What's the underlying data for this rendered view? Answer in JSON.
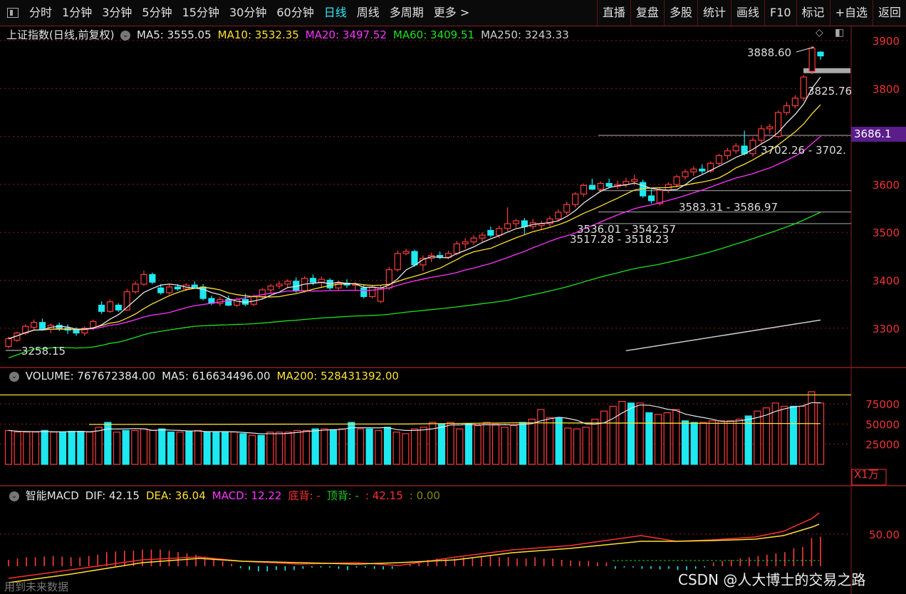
{
  "toolbar": {
    "periods": [
      "分时",
      "1分钟",
      "3分钟",
      "5分钟",
      "15分钟",
      "30分钟",
      "60分钟",
      "日线",
      "周线",
      "多周期",
      "更多 >"
    ],
    "active": "日线",
    "right": [
      "直播",
      "复盘",
      "多股",
      "统计",
      "画线",
      "F10",
      "标记",
      "+自选",
      "返回"
    ]
  },
  "price_panel": {
    "title": "上证指数(日线,前复权)",
    "ma_labels": [
      {
        "text": "MA5: 3555.05",
        "color": "#e6e6e6"
      },
      {
        "text": "MA10: 3532.35",
        "color": "#ffe033"
      },
      {
        "text": "MA20: 3497.52",
        "color": "#ff33ff"
      },
      {
        "text": "MA60: 3409.51",
        "color": "#1ee11e"
      },
      {
        "text": "MA250: 3243.33",
        "color": "#cccccc"
      }
    ],
    "axis_ticks": [
      "3900",
      "3800",
      "3700",
      "3600",
      "3500",
      "3400",
      "3300"
    ],
    "current_price": "3686.1",
    "high_label": "3888.60",
    "low_label": "3258.15",
    "level_labels": [
      "3825.76",
      "3702.26 - 3702.",
      "3583.31 - 3586.97",
      "3536.01 - 3542.57",
      "3517.28 - 3518.23"
    ]
  },
  "volume_panel": {
    "labels": [
      {
        "text": "VOLUME: 767672384.00",
        "color": "#e6e6e6"
      },
      {
        "text": "MA5: 616634496.00",
        "color": "#e6e6e6"
      },
      {
        "text": "MA200: 528431392.00",
        "color": "#ffe033"
      }
    ],
    "axis_ticks": [
      "75000",
      "50000",
      "25000"
    ],
    "unit": "X1万"
  },
  "macd_panel": {
    "labels": [
      {
        "text": "智能MACD",
        "color": "#e6e6e6"
      },
      {
        "text": "DIF: 42.15",
        "color": "#e6e6e6"
      },
      {
        "text": "DEA: 36.04",
        "color": "#ffe033"
      },
      {
        "text": "MACD: 12.22",
        "color": "#ff33ff"
      },
      {
        "text": "底背: -",
        "color": "#ff3030"
      },
      {
        "text": "顶背: -",
        "color": "#1ec81e"
      },
      {
        "text": ": 42.15",
        "color": "#ff3030"
      },
      {
        "text": ": 0.00",
        "color": "#888800"
      }
    ],
    "axis_ticks": [
      "50.00"
    ]
  },
  "footer_text": "用到未来数据",
  "watermark": "CSDN @人大博士的交易之路",
  "colors": {
    "up": "#ff3b3b",
    "down": "#1ee8f0",
    "ma5": "#e6e6e6",
    "ma10": "#ffe033",
    "ma20": "#ff33ff",
    "ma60": "#1ee11e",
    "ma250": "#cccccc",
    "grid": "#8a1e1e"
  },
  "chart_data": {
    "type": "candlestick",
    "title": "上证指数(日线,前复权)",
    "ylim": [
      3230,
      3920
    ],
    "candles": [
      {
        "o": 3262,
        "h": 3282,
        "l": 3258,
        "c": 3278
      },
      {
        "o": 3275,
        "h": 3293,
        "l": 3271,
        "c": 3290
      },
      {
        "o": 3290,
        "h": 3308,
        "l": 3286,
        "c": 3304
      },
      {
        "o": 3302,
        "h": 3318,
        "l": 3296,
        "c": 3312
      },
      {
        "o": 3312,
        "h": 3320,
        "l": 3295,
        "c": 3298
      },
      {
        "o": 3298,
        "h": 3310,
        "l": 3290,
        "c": 3306
      },
      {
        "o": 3306,
        "h": 3312,
        "l": 3294,
        "c": 3300
      },
      {
        "o": 3300,
        "h": 3308,
        "l": 3288,
        "c": 3296
      },
      {
        "o": 3296,
        "h": 3302,
        "l": 3284,
        "c": 3290
      },
      {
        "o": 3290,
        "h": 3304,
        "l": 3284,
        "c": 3300
      },
      {
        "o": 3300,
        "h": 3318,
        "l": 3296,
        "c": 3314
      },
      {
        "o": 3348,
        "h": 3356,
        "l": 3330,
        "c": 3335
      },
      {
        "o": 3335,
        "h": 3360,
        "l": 3332,
        "c": 3355
      },
      {
        "o": 3348,
        "h": 3352,
        "l": 3334,
        "c": 3338
      },
      {
        "o": 3338,
        "h": 3382,
        "l": 3336,
        "c": 3376
      },
      {
        "o": 3376,
        "h": 3398,
        "l": 3372,
        "c": 3392
      },
      {
        "o": 3392,
        "h": 3420,
        "l": 3388,
        "c": 3412
      },
      {
        "o": 3412,
        "h": 3416,
        "l": 3392,
        "c": 3396
      },
      {
        "o": 3384,
        "h": 3392,
        "l": 3370,
        "c": 3374
      },
      {
        "o": 3374,
        "h": 3392,
        "l": 3370,
        "c": 3386
      },
      {
        "o": 3386,
        "h": 3392,
        "l": 3378,
        "c": 3382
      },
      {
        "o": 3382,
        "h": 3394,
        "l": 3378,
        "c": 3390
      },
      {
        "o": 3390,
        "h": 3398,
        "l": 3383,
        "c": 3386
      },
      {
        "o": 3386,
        "h": 3392,
        "l": 3358,
        "c": 3362
      },
      {
        "o": 3362,
        "h": 3368,
        "l": 3348,
        "c": 3352
      },
      {
        "o": 3352,
        "h": 3366,
        "l": 3346,
        "c": 3360
      },
      {
        "o": 3360,
        "h": 3368,
        "l": 3346,
        "c": 3348
      },
      {
        "o": 3348,
        "h": 3364,
        "l": 3344,
        "c": 3360
      },
      {
        "o": 3360,
        "h": 3372,
        "l": 3346,
        "c": 3350
      },
      {
        "o": 3350,
        "h": 3370,
        "l": 3346,
        "c": 3366
      },
      {
        "o": 3366,
        "h": 3384,
        "l": 3362,
        "c": 3380
      },
      {
        "o": 3380,
        "h": 3392,
        "l": 3372,
        "c": 3388
      },
      {
        "o": 3388,
        "h": 3398,
        "l": 3382,
        "c": 3392
      },
      {
        "o": 3392,
        "h": 3402,
        "l": 3384,
        "c": 3398
      },
      {
        "o": 3398,
        "h": 3406,
        "l": 3374,
        "c": 3378
      },
      {
        "o": 3378,
        "h": 3408,
        "l": 3374,
        "c": 3404
      },
      {
        "o": 3404,
        "h": 3412,
        "l": 3390,
        "c": 3396
      },
      {
        "o": 3396,
        "h": 3408,
        "l": 3384,
        "c": 3402
      },
      {
        "o": 3400,
        "h": 3404,
        "l": 3380,
        "c": 3384
      },
      {
        "o": 3384,
        "h": 3398,
        "l": 3378,
        "c": 3394
      },
      {
        "o": 3394,
        "h": 3402,
        "l": 3384,
        "c": 3390
      },
      {
        "o": 3390,
        "h": 3396,
        "l": 3380,
        "c": 3392
      },
      {
        "o": 3384,
        "h": 3392,
        "l": 3362,
        "c": 3366
      },
      {
        "o": 3366,
        "h": 3390,
        "l": 3362,
        "c": 3386
      },
      {
        "o": 3356,
        "h": 3390,
        "l": 3352,
        "c": 3384
      },
      {
        "o": 3384,
        "h": 3428,
        "l": 3380,
        "c": 3422
      },
      {
        "o": 3422,
        "h": 3462,
        "l": 3418,
        "c": 3456
      },
      {
        "o": 3456,
        "h": 3466,
        "l": 3452,
        "c": 3460
      },
      {
        "o": 3460,
        "h": 3464,
        "l": 3428,
        "c": 3432
      },
      {
        "o": 3432,
        "h": 3452,
        "l": 3420,
        "c": 3446
      },
      {
        "o": 3446,
        "h": 3458,
        "l": 3438,
        "c": 3452
      },
      {
        "o": 3452,
        "h": 3460,
        "l": 3444,
        "c": 3448
      },
      {
        "o": 3448,
        "h": 3462,
        "l": 3444,
        "c": 3456
      },
      {
        "o": 3456,
        "h": 3482,
        "l": 3452,
        "c": 3476
      },
      {
        "o": 3476,
        "h": 3488,
        "l": 3466,
        "c": 3480
      },
      {
        "o": 3480,
        "h": 3494,
        "l": 3474,
        "c": 3488
      },
      {
        "o": 3488,
        "h": 3500,
        "l": 3480,
        "c": 3494
      },
      {
        "o": 3504,
        "h": 3512,
        "l": 3490,
        "c": 3494
      },
      {
        "o": 3494,
        "h": 3514,
        "l": 3488,
        "c": 3508
      },
      {
        "o": 3508,
        "h": 3552,
        "l": 3502,
        "c": 3518
      },
      {
        "o": 3518,
        "h": 3528,
        "l": 3510,
        "c": 3524
      },
      {
        "o": 3524,
        "h": 3530,
        "l": 3496,
        "c": 3512
      },
      {
        "o": 3512,
        "h": 3528,
        "l": 3506,
        "c": 3520
      },
      {
        "o": 3514,
        "h": 3524,
        "l": 3506,
        "c": 3518
      },
      {
        "o": 3518,
        "h": 3534,
        "l": 3512,
        "c": 3528
      },
      {
        "o": 3528,
        "h": 3548,
        "l": 3522,
        "c": 3542
      },
      {
        "o": 3542,
        "h": 3564,
        "l": 3536,
        "c": 3558
      },
      {
        "o": 3558,
        "h": 3584,
        "l": 3552,
        "c": 3580
      },
      {
        "o": 3580,
        "h": 3602,
        "l": 3574,
        "c": 3598
      },
      {
        "o": 3598,
        "h": 3612,
        "l": 3588,
        "c": 3590
      },
      {
        "o": 3590,
        "h": 3606,
        "l": 3584,
        "c": 3602
      },
      {
        "o": 3602,
        "h": 3612,
        "l": 3592,
        "c": 3596
      },
      {
        "o": 3596,
        "h": 3608,
        "l": 3590,
        "c": 3600
      },
      {
        "o": 3600,
        "h": 3614,
        "l": 3594,
        "c": 3606
      },
      {
        "o": 3606,
        "h": 3620,
        "l": 3598,
        "c": 3610
      },
      {
        "o": 3604,
        "h": 3610,
        "l": 3572,
        "c": 3576
      },
      {
        "o": 3576,
        "h": 3590,
        "l": 3560,
        "c": 3566
      },
      {
        "o": 3560,
        "h": 3592,
        "l": 3556,
        "c": 3588
      },
      {
        "o": 3588,
        "h": 3604,
        "l": 3582,
        "c": 3600
      },
      {
        "o": 3600,
        "h": 3620,
        "l": 3594,
        "c": 3616
      },
      {
        "o": 3616,
        "h": 3632,
        "l": 3610,
        "c": 3626
      },
      {
        "o": 3626,
        "h": 3638,
        "l": 3618,
        "c": 3632
      },
      {
        "o": 3632,
        "h": 3642,
        "l": 3622,
        "c": 3628
      },
      {
        "o": 3628,
        "h": 3648,
        "l": 3624,
        "c": 3644
      },
      {
        "o": 3644,
        "h": 3664,
        "l": 3640,
        "c": 3660
      },
      {
        "o": 3660,
        "h": 3676,
        "l": 3652,
        "c": 3670
      },
      {
        "o": 3670,
        "h": 3686,
        "l": 3664,
        "c": 3680
      },
      {
        "o": 3680,
        "h": 3712,
        "l": 3660,
        "c": 3664
      },
      {
        "o": 3664,
        "h": 3698,
        "l": 3658,
        "c": 3692
      },
      {
        "o": 3692,
        "h": 3724,
        "l": 3686,
        "c": 3716
      },
      {
        "o": 3716,
        "h": 3726,
        "l": 3706,
        "c": 3720
      },
      {
        "o": 3700,
        "h": 3754,
        "l": 3696,
        "c": 3750
      },
      {
        "o": 3750,
        "h": 3772,
        "l": 3744,
        "c": 3764
      },
      {
        "o": 3764,
        "h": 3786,
        "l": 3758,
        "c": 3780
      },
      {
        "o": 3780,
        "h": 3828,
        "l": 3774,
        "c": 3824
      },
      {
        "o": 3836,
        "h": 3889,
        "l": 3830,
        "c": 3884
      },
      {
        "o": 3876,
        "h": 3878,
        "l": 3860,
        "c": 3868
      }
    ],
    "ma250": {
      "from_index": 73,
      "start": 3253,
      "end": 3317
    },
    "volume": [
      42,
      40,
      40,
      40,
      42,
      40,
      40,
      41,
      41,
      40,
      46,
      52,
      40,
      42,
      42,
      44,
      42,
      44,
      40,
      40,
      41,
      42,
      40,
      40,
      40,
      40,
      38,
      36,
      36,
      40,
      40,
      40,
      42,
      42,
      44,
      44,
      43,
      44,
      52,
      44,
      44,
      42,
      46,
      40,
      38,
      44,
      46,
      52,
      50,
      52,
      44,
      50,
      48,
      52,
      50,
      46,
      48,
      52,
      56,
      68,
      58,
      58,
      45,
      44,
      46,
      56,
      66,
      72,
      78,
      76,
      76,
      64,
      62,
      64,
      68,
      54,
      52,
      52,
      54,
      54,
      54,
      56,
      60,
      66,
      70,
      76,
      72,
      72,
      72,
      90,
      76
    ],
    "volume_ma200": 50000,
    "macd_hist": [
      10,
      12,
      14,
      14,
      15,
      16,
      15,
      14,
      14,
      16,
      18,
      22,
      23,
      24,
      24,
      26,
      26,
      26,
      24,
      22,
      20,
      18,
      15,
      12,
      8,
      4,
      -3,
      -6,
      -8,
      -8,
      -6,
      -7,
      -6,
      -4,
      -2,
      -2,
      -2,
      -4,
      -6,
      -2,
      -2,
      -4,
      -5,
      -4,
      0,
      4,
      8,
      10,
      12,
      12,
      12,
      14,
      14,
      16,
      16,
      14,
      14,
      12,
      12,
      14,
      12,
      12,
      10,
      9,
      8,
      8,
      6,
      6,
      -4,
      -2,
      -2,
      -4,
      -4,
      -5,
      -4,
      -6,
      -6,
      -4,
      -2,
      6,
      8,
      10,
      12,
      14,
      16,
      18,
      20,
      22,
      28,
      30,
      44,
      46
    ]
  }
}
